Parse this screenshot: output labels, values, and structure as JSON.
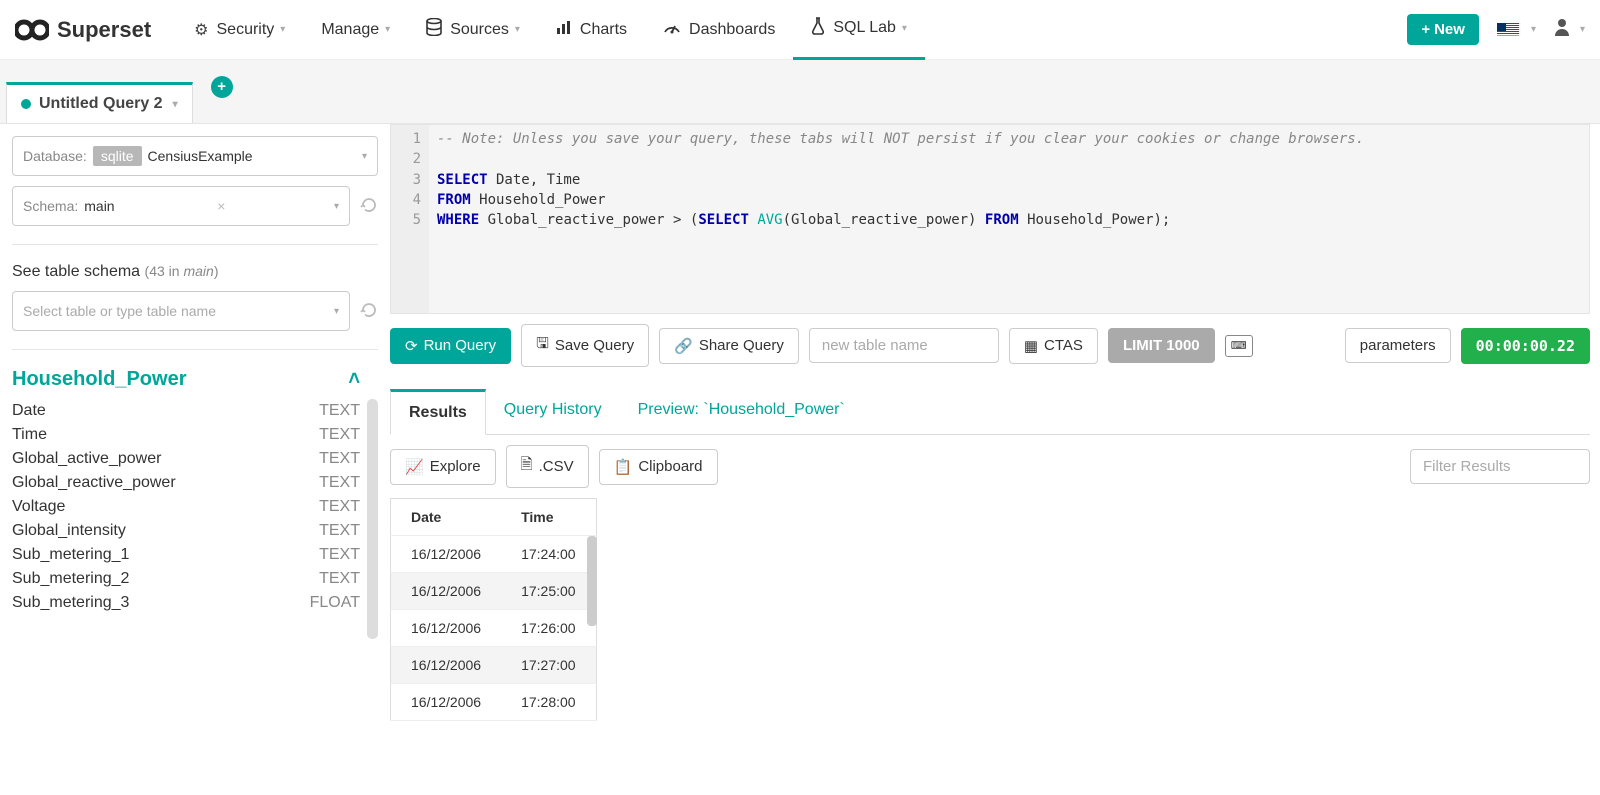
{
  "brand": "Superset",
  "nav": {
    "security": "Security",
    "manage": "Manage",
    "sources": "Sources",
    "charts": "Charts",
    "dashboards": "Dashboards",
    "sql_lab": "SQL Lab",
    "new_btn": "New"
  },
  "query_tab": {
    "title": "Untitled Query 2"
  },
  "sidebar": {
    "db_label": "Database:",
    "db_chip": "sqlite",
    "db_value": "CensiusExample",
    "schema_label": "Schema:",
    "schema_value": "main",
    "see_schema": "See table schema",
    "schema_meta": "(43 in main)",
    "table_select_ph": "Select table or type table name",
    "table_name": "Household_Power",
    "columns": [
      {
        "name": "Date",
        "type": "TEXT"
      },
      {
        "name": "Time",
        "type": "TEXT"
      },
      {
        "name": "Global_active_power",
        "type": "TEXT"
      },
      {
        "name": "Global_reactive_power",
        "type": "TEXT"
      },
      {
        "name": "Voltage",
        "type": "TEXT"
      },
      {
        "name": "Global_intensity",
        "type": "TEXT"
      },
      {
        "name": "Sub_metering_1",
        "type": "TEXT"
      },
      {
        "name": "Sub_metering_2",
        "type": "TEXT"
      },
      {
        "name": "Sub_metering_3",
        "type": "FLOAT"
      }
    ]
  },
  "editor": {
    "lines": [
      "1",
      "2",
      "3",
      "4",
      "5"
    ],
    "comment": "-- Note: Unless you save your query, these tabs will NOT persist if you clear your cookies or change browsers.",
    "l3a": "SELECT",
    "l3b": " Date, Time",
    "l4a": "FROM",
    "l4b": " Household_Power",
    "l5a": "WHERE",
    "l5b": " Global_reactive_power > (",
    "l5c": "SELECT",
    "l5d": " ",
    "l5e": "AVG",
    "l5f": "(Global_reactive_power) ",
    "l5g": "FROM",
    "l5h": " Household_Power);"
  },
  "toolbar": {
    "run": "Run Query",
    "save": "Save Query",
    "share": "Share Query",
    "new_table_ph": "new table name",
    "ctas": "CTAS",
    "limit": "LIMIT 1000",
    "params": "parameters",
    "timer": "00:00:00.22"
  },
  "tabs": {
    "results": "Results",
    "history": "Query History",
    "preview": "Preview: `Household_Power`"
  },
  "result_tools": {
    "explore": "Explore",
    "csv": ".CSV",
    "clipboard": "Clipboard",
    "filter_ph": "Filter Results"
  },
  "results": {
    "headers": [
      "Date",
      "Time"
    ],
    "rows": [
      [
        "16/12/2006",
        "17:24:00"
      ],
      [
        "16/12/2006",
        "17:25:00"
      ],
      [
        "16/12/2006",
        "17:26:00"
      ],
      [
        "16/12/2006",
        "17:27:00"
      ],
      [
        "16/12/2006",
        "17:28:00"
      ]
    ]
  }
}
